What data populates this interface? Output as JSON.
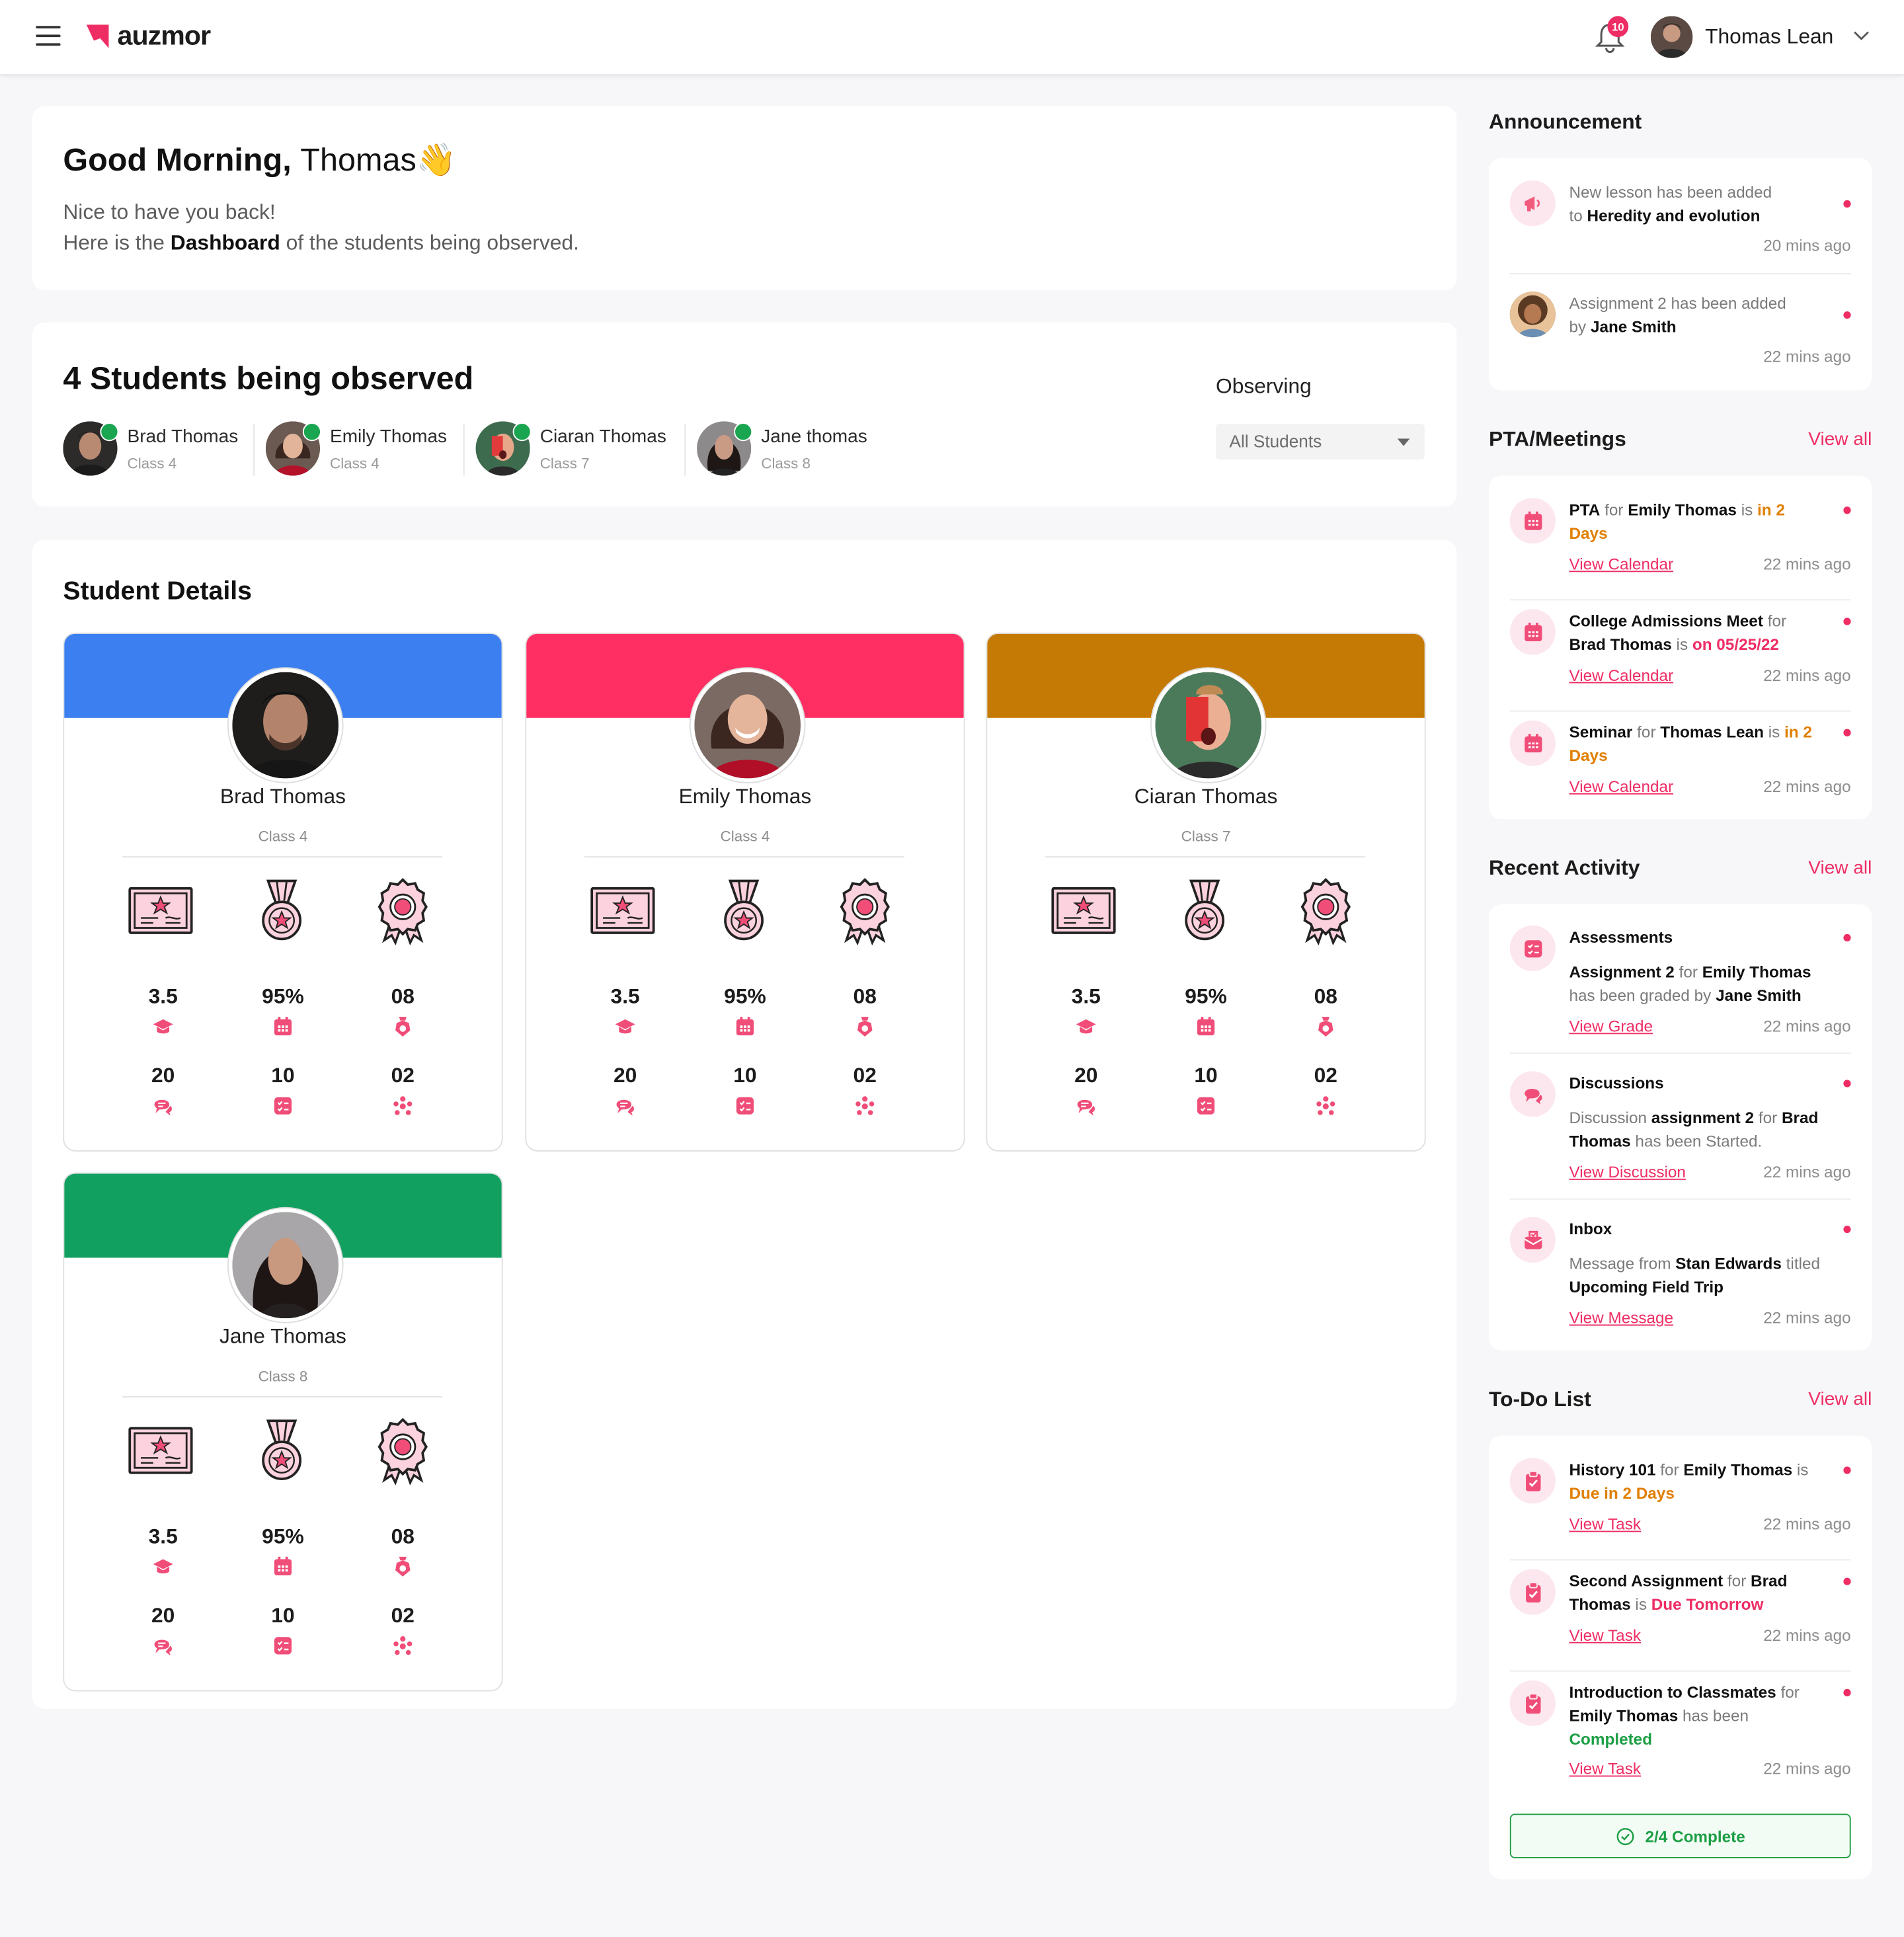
{
  "app": {
    "logo_text": "auzmor",
    "brand_color": "#ee2d64"
  },
  "header": {
    "notifications_count": "10",
    "user_name": "Thomas Lean"
  },
  "greeting": {
    "title_bold": "Good Morning,",
    "title_name": "Thomas",
    "emoji": "👋",
    "line1": "Nice to have you back!",
    "line2_pre": "Here is the",
    "line2_bold": "Dashboard",
    "line2_post": "of the students being observed."
  },
  "observed": {
    "title": "4 Students being observed",
    "students": [
      {
        "name": "Brad Thomas",
        "class": "Class 4"
      },
      {
        "name": "Emily Thomas",
        "class": "Class 4"
      },
      {
        "name": "Ciaran Thomas",
        "class": "Class 7"
      },
      {
        "name": "Jane thomas",
        "class": "Class 8"
      }
    ],
    "observing_label": "Observing",
    "select_value": "All Students"
  },
  "student_details": {
    "title": "Student Details",
    "cards": [
      {
        "name": "Brad Thomas",
        "class": "Class 4",
        "band_color": "#3b7ff0",
        "gpa": "3.5",
        "attendance": "95%",
        "badges": "08",
        "discussions": "20",
        "assignments": "10",
        "groups": "02"
      },
      {
        "name": "Emily Thomas",
        "class": "Class 4",
        "band_color": "#ff2f64",
        "gpa": "3.5",
        "attendance": "95%",
        "badges": "08",
        "discussions": "20",
        "assignments": "10",
        "groups": "02"
      },
      {
        "name": "Ciaran Thomas",
        "class": "Class 7",
        "band_color": "#c67a06",
        "gpa": "3.5",
        "attendance": "95%",
        "badges": "08",
        "discussions": "20",
        "assignments": "10",
        "groups": "02"
      },
      {
        "name": "Jane Thomas",
        "class": "Class 8",
        "band_color": "#12a061",
        "gpa": "3.5",
        "attendance": "95%",
        "badges": "08",
        "discussions": "20",
        "assignments": "10",
        "groups": "02"
      }
    ]
  },
  "announcement": {
    "title": "Announcement",
    "items": [
      {
        "t1": "New lesson has been added",
        "t2": "to",
        "bold": "Heredity and evolution",
        "time": "20 mins ago"
      },
      {
        "t1": "Assignment 2 has been added",
        "t2": "by",
        "bold": "Jane Smith",
        "time": "22 mins ago"
      }
    ]
  },
  "pta": {
    "title": "PTA/Meetings",
    "view_all": "View all",
    "items": [
      {
        "bold1": "PTA",
        "mid1": "for",
        "bold2": "Emily Thomas",
        "mid2": "is",
        "highlight": "in 2 Days",
        "link": "View Calendar",
        "time": "22 mins ago"
      },
      {
        "bold1": "College Admissions Meet",
        "mid1": "for",
        "bold2": "Brad Thomas",
        "mid2": "is",
        "highlight": "on 05/25/22",
        "link": "View Calendar",
        "time": "22 mins ago"
      },
      {
        "bold1": "Seminar",
        "mid1": "for",
        "bold2": "Thomas Lean",
        "mid2": "is",
        "highlight": "in 2 Days",
        "link": "View Calendar",
        "time": "22 mins ago"
      }
    ]
  },
  "recent": {
    "title": "Recent Activity",
    "view_all": "View all",
    "items": [
      {
        "heading": "Assessments",
        "b1": "Assignment 2",
        "m1": "for",
        "b2": "Emily Thomas",
        "m2": "has been graded by",
        "b3": "Jane Smith",
        "link": "View Grade",
        "time": "22 mins ago"
      },
      {
        "heading": "Discussions",
        "m0": "Discussion",
        "b1": "assignment 2",
        "m1": "for",
        "b2": "Brad Thomas",
        "m2": "has been Started.",
        "link": "View Discussion",
        "time": "22 mins ago"
      },
      {
        "heading": "Inbox",
        "m0": "Message from",
        "b1": "Stan Edwards",
        "m1": "titled",
        "b2": "Upcoming Field Trip",
        "link": "View Message",
        "time": "22 mins ago"
      }
    ]
  },
  "todo": {
    "title": "To-Do List",
    "view_all": "View all",
    "items": [
      {
        "b1": "History 101",
        "m1": "for",
        "b2": "Emily Thomas",
        "m2": "is",
        "status": "Due in 2 Days",
        "link": "View Task",
        "time": "22 mins ago"
      },
      {
        "b1": "Second Assignment",
        "m1": "for",
        "b2": "Brad Thomas",
        "m2": "is",
        "status": "Due Tomorrow",
        "link": "View Task",
        "time": "22 mins ago"
      },
      {
        "b1": "Introduction to Classmates",
        "m1": "for",
        "b2": "Emily Thomas",
        "m2": "has been",
        "status": "Completed",
        "link": "View Task",
        "time": "22 mins ago"
      }
    ],
    "progress": "2/4 Complete"
  }
}
